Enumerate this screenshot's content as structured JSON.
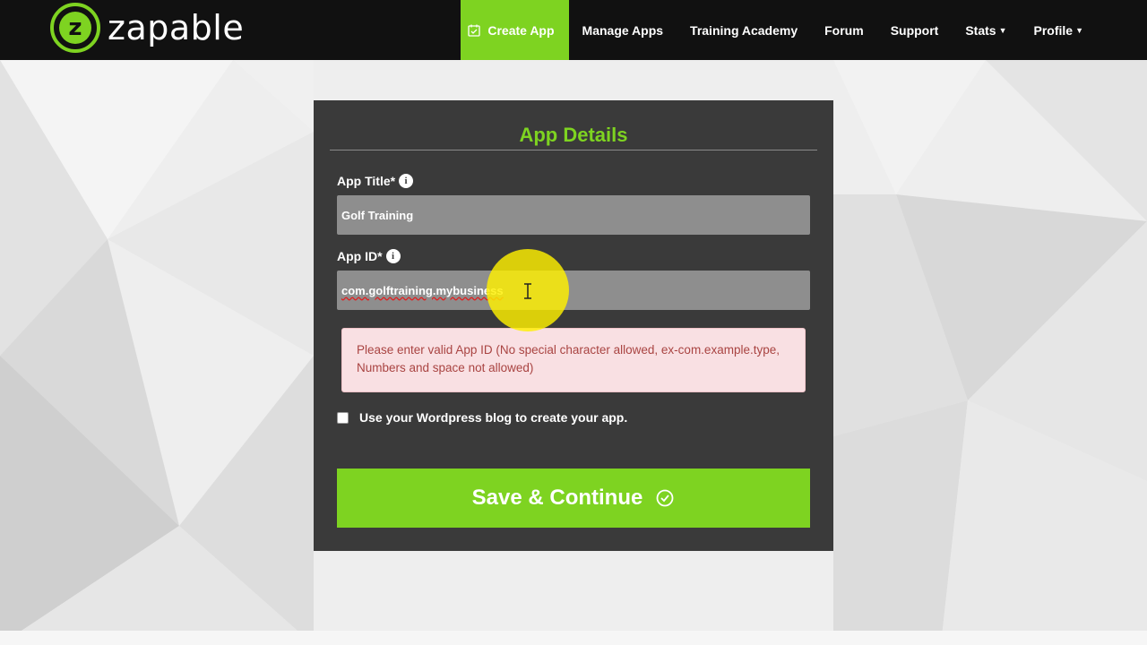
{
  "brand": {
    "name": "zapable",
    "mark": "z"
  },
  "nav": {
    "items": [
      {
        "label": "Create App",
        "active": true
      },
      {
        "label": "Manage Apps"
      },
      {
        "label": "Training Academy"
      },
      {
        "label": "Forum"
      },
      {
        "label": "Support"
      },
      {
        "label": "Stats",
        "dropdown": true
      },
      {
        "label": "Profile",
        "dropdown": true
      }
    ]
  },
  "card": {
    "title": "App Details",
    "app_title": {
      "label": "App Title*",
      "value": "Golf Training"
    },
    "app_id": {
      "label": "App ID*",
      "value": "com.golftraining.mybusiness"
    },
    "error": "Please enter valid App ID (No special character allowed, ex-com.example.type, Numbers and space not allowed)",
    "wordpress_checkbox": {
      "label": "Use your Wordpress blog to create your app.",
      "checked": false
    },
    "save_button": "Save & Continue"
  },
  "colors": {
    "accent": "#7ed321",
    "topbar": "#111111",
    "card": "#3a3a3a",
    "input": "#8e8e8e",
    "error_bg": "#f9e0e3",
    "error_text": "#a94442"
  }
}
